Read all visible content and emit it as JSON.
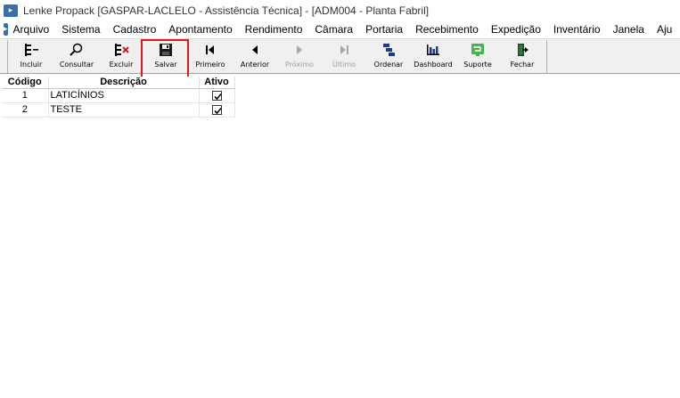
{
  "window": {
    "title": "Lenke Propack [GASPAR-LACLELO - Assistência Técnica] - [ADM004 - Planta Fabril]"
  },
  "menu": {
    "items": [
      {
        "label": "Arquivo"
      },
      {
        "label": "Sistema"
      },
      {
        "label": "Cadastro"
      },
      {
        "label": "Apontamento"
      },
      {
        "label": "Rendimento"
      },
      {
        "label": "Câmara"
      },
      {
        "label": "Portaria"
      },
      {
        "label": "Recebimento"
      },
      {
        "label": "Expedição"
      },
      {
        "label": "Inventário"
      },
      {
        "label": "Janela"
      },
      {
        "label": "Aju"
      }
    ]
  },
  "toolbar": {
    "buttons": [
      {
        "label": "Incluir",
        "icon": "add-icon",
        "enabled": true
      },
      {
        "label": "Consultar",
        "icon": "search-icon",
        "enabled": true
      },
      {
        "label": "Excluir",
        "icon": "delete-icon",
        "enabled": true
      },
      {
        "label": "Salvar",
        "icon": "save-icon",
        "enabled": true
      },
      {
        "label": "Primeiro",
        "icon": "first-icon",
        "enabled": true
      },
      {
        "label": "Anterior",
        "icon": "previous-icon",
        "enabled": true
      },
      {
        "label": "Próximo",
        "icon": "next-icon",
        "enabled": false
      },
      {
        "label": "Último",
        "icon": "last-icon",
        "enabled": false
      },
      {
        "label": "Ordenar",
        "icon": "sort-icon",
        "enabled": true
      },
      {
        "label": "Dashboard",
        "icon": "dashboard-icon",
        "enabled": true
      },
      {
        "label": "Suporte",
        "icon": "support-icon",
        "enabled": true
      },
      {
        "label": "Fechar",
        "icon": "exit-icon",
        "enabled": true
      }
    ]
  },
  "table": {
    "columns": [
      "Código",
      "Descrição",
      "Ativo"
    ],
    "rows": [
      {
        "code": "1",
        "description": "LATICÍNIOS",
        "active": true
      },
      {
        "code": "2",
        "description": "TESTE",
        "active": true
      }
    ]
  },
  "colors": {
    "highlight": "#e0191c",
    "app_icon": "#3b6ea8",
    "toolbar_bg": "#f0f0f0"
  }
}
